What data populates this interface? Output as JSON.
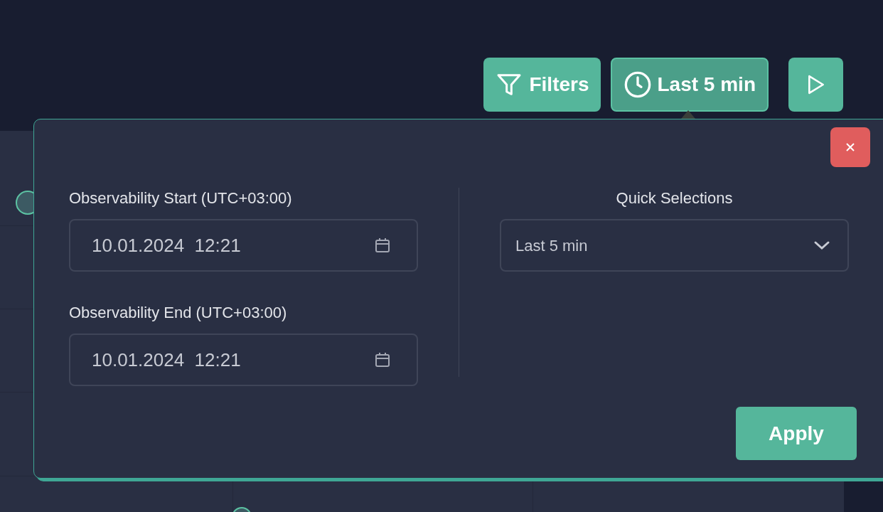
{
  "toolbar": {
    "buttons": [
      {
        "kind": "filters",
        "label": "Filters",
        "selected": false
      },
      {
        "kind": "time",
        "label": "Last 5 min",
        "selected": true
      },
      {
        "kind": "play",
        "selected": false
      }
    ]
  },
  "time_popover": {
    "start": {
      "label": "Observability Start (UTC+03:00)",
      "value": "10.01.2024  12:21"
    },
    "end": {
      "label": "Observability End (UTC+03:00)",
      "value": "10.01.2024  12:21"
    },
    "quick_selections": {
      "label": "Quick Selections",
      "value": "Last 5 min"
    },
    "apply": "Apply"
  }
}
